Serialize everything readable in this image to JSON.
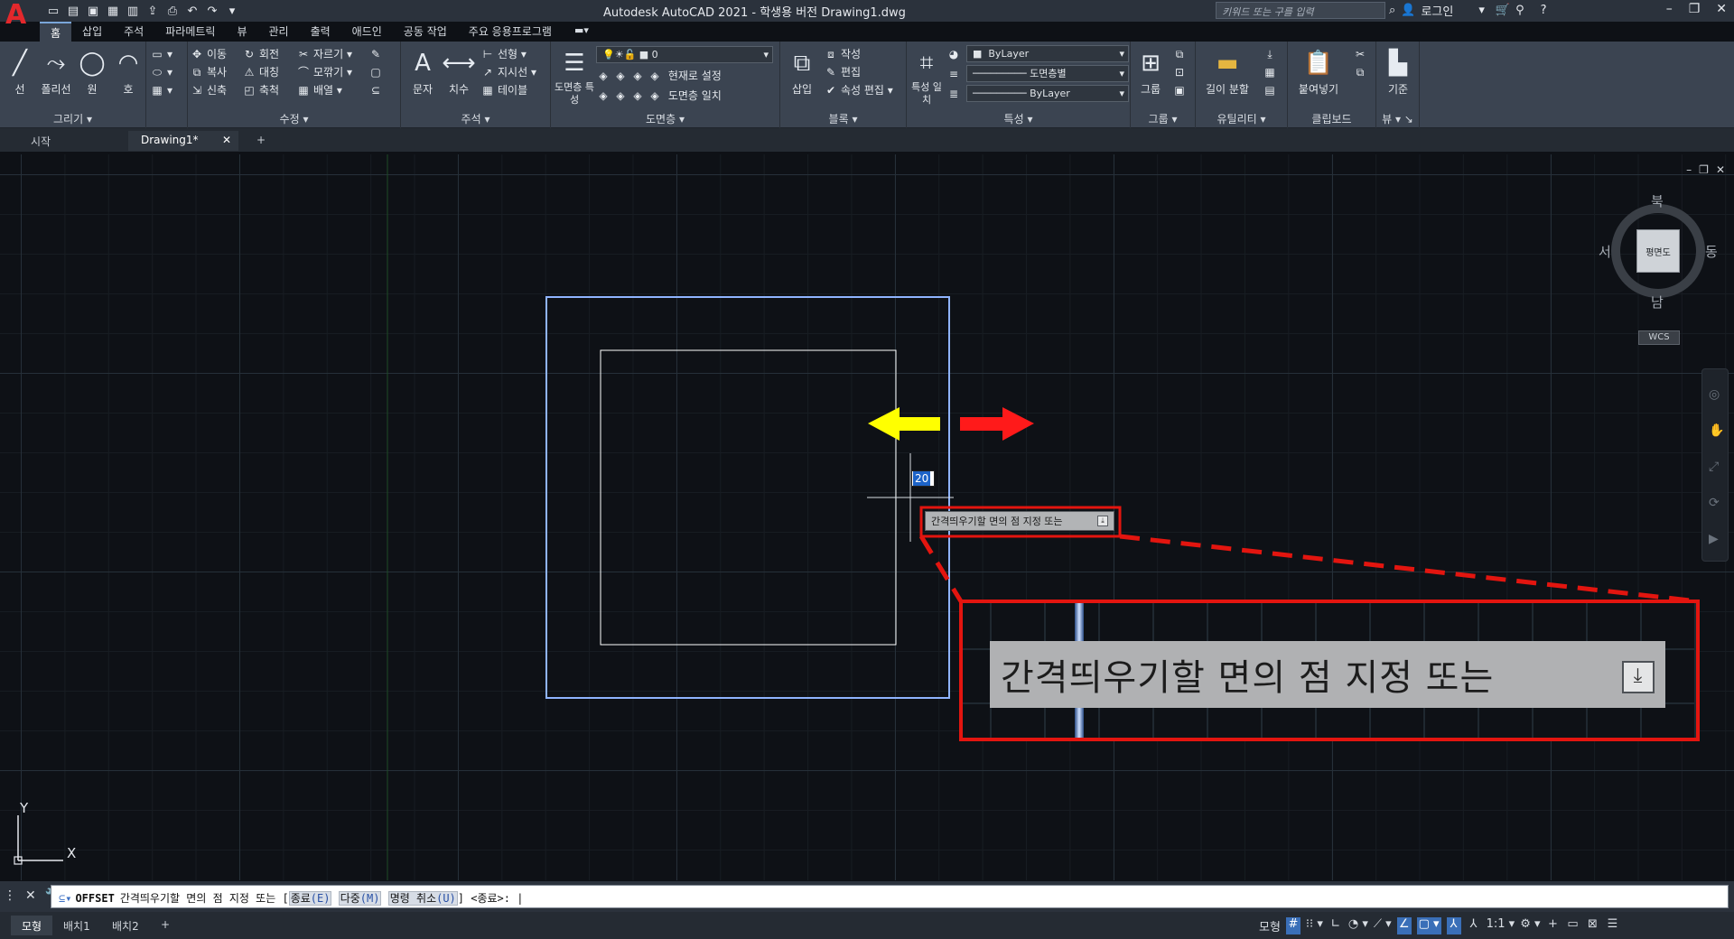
{
  "titlebar": {
    "title": "Autodesk AutoCAD 2021 - 학생용 버전    Drawing1.dwg",
    "search_placeholder": "키워드 또는 구를 입력",
    "login_label": "로그인"
  },
  "ribbon_tabs": [
    "홈",
    "삽입",
    "주석",
    "파라메트릭",
    "뷰",
    "관리",
    "출력",
    "애드인",
    "공동 작업",
    "주요 응용프로그램"
  ],
  "ribbon": {
    "draw": {
      "title": "그리기",
      "line": "선",
      "polyline": "폴리선",
      "circle": "원",
      "arc": "호"
    },
    "modify": {
      "title": "수정",
      "move": "이동",
      "rotate": "회전",
      "trim": "자르기",
      "copy": "복사",
      "mirror": "대칭",
      "fillet": "모깎기",
      "stretch": "신축",
      "scale": "축척",
      "array": "배열"
    },
    "annotation": {
      "title": "주석",
      "text": "문자",
      "dimension": "치수",
      "linear": "선형",
      "leader": "지시선",
      "table": "테이블"
    },
    "layers": {
      "title": "도면층",
      "layer_props": "도면층 특성",
      "current_layer": "0",
      "make_current": "현재로 설정",
      "match_layer": "도면층 일치"
    },
    "block": {
      "title": "블록",
      "insert": "삽입",
      "create": "작성",
      "edit": "편집",
      "edit_attributes": "속성 편집"
    },
    "properties": {
      "title": "특성",
      "match_props": "특성 일치",
      "color": "ByLayer",
      "linetype": "도면층별",
      "lineweight": "ByLayer"
    },
    "groups": {
      "title": "그룹",
      "group": "그룹"
    },
    "utilities": {
      "title": "유틸리티",
      "measure": "길이 분할"
    },
    "clipboard": {
      "title": "클립보드",
      "paste": "붙여넣기"
    },
    "view": {
      "title": "뷰",
      "base": "기준"
    }
  },
  "doc_tabs": [
    "시작",
    "Drawing1*"
  ],
  "viewcube": {
    "north": "북",
    "south": "남",
    "east": "동",
    "west": "서",
    "face": "평면도",
    "wcs": "WCS"
  },
  "drawing": {
    "dynamic_value": "20",
    "tooltip": "간격띄우기할 면의 점 지정 또는",
    "callout_text": "간격띄우기할 면의 점 지정 또는",
    "colors": {
      "outer_rect": "#8fb4ff",
      "inner_rect": "#ffffff",
      "arrow_left": "#ffff00",
      "arrow_right": "#ff1a1a",
      "callout_border": "#e3150f"
    }
  },
  "ucs": {
    "x_label": "X",
    "y_label": "Y"
  },
  "command": {
    "name": "OFFSET",
    "prompt": "간격띄우기할 면의 점 지정 또는 [",
    "opt_exit": "종료",
    "opt_exit_key": "(E)",
    "opt_multiple": "다중",
    "opt_multiple_key": "(M)",
    "opt_undo": "명령 취소",
    "opt_undo_key": "(U)",
    "suffix": "] <종료>: |"
  },
  "status": {
    "tabs": [
      "모형",
      "배치1",
      "배치2"
    ],
    "model_label": "모형",
    "scale": "1:1"
  }
}
